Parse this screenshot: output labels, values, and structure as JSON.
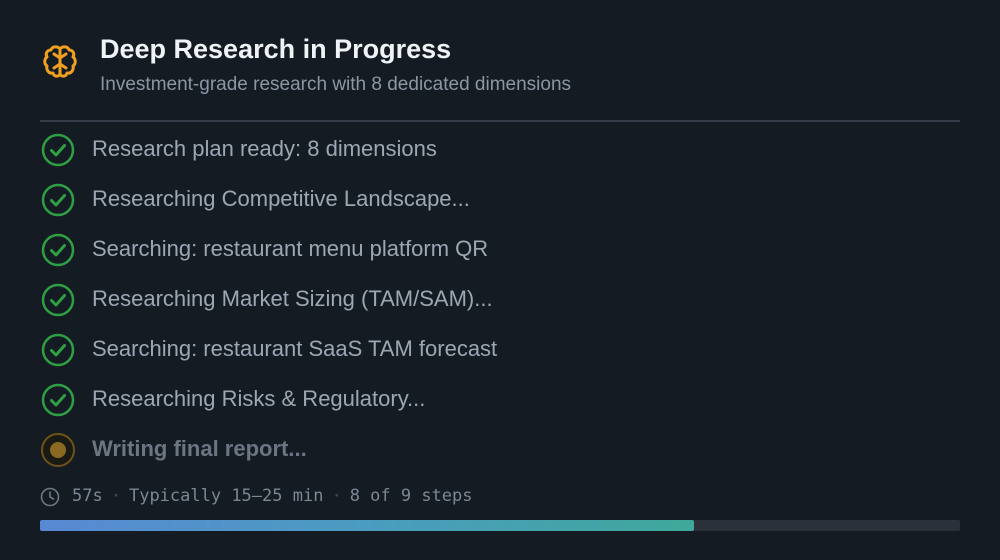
{
  "header": {
    "icon": "brain-icon",
    "title": "Deep Research in Progress",
    "subtitle": "Investment-grade research with 8 dedicated dimensions"
  },
  "steps": [
    {
      "label": "Research plan ready: 8 dimensions",
      "status": "done",
      "icon": "check-circle-icon"
    },
    {
      "label": "Researching Competitive Landscape...",
      "status": "done",
      "icon": "check-circle-icon"
    },
    {
      "label": "Searching: restaurant menu platform QR",
      "status": "done",
      "icon": "check-circle-icon"
    },
    {
      "label": "Researching Market Sizing (TAM/SAM)...",
      "status": "done",
      "icon": "check-circle-icon"
    },
    {
      "label": "Searching: restaurant SaaS TAM forecast",
      "status": "done",
      "icon": "check-circle-icon"
    },
    {
      "label": "Researching Risks & Regulatory...",
      "status": "done",
      "icon": "check-circle-icon"
    },
    {
      "label": "Writing final report...",
      "status": "active",
      "icon": "in-progress-dot-icon"
    }
  ],
  "footer": {
    "icon": "clock-icon",
    "elapsed": "57s",
    "typical": "Typically 15–25 min",
    "steps_count": "8 of 9 steps",
    "separator": "·",
    "progress_fraction": 0.711
  },
  "colors": {
    "background": "#151b23",
    "done": "#2ea043",
    "active": "#b07a12",
    "brain": "#f0a020",
    "progress_start": "#5889d4",
    "progress_end": "#3fa89a"
  }
}
